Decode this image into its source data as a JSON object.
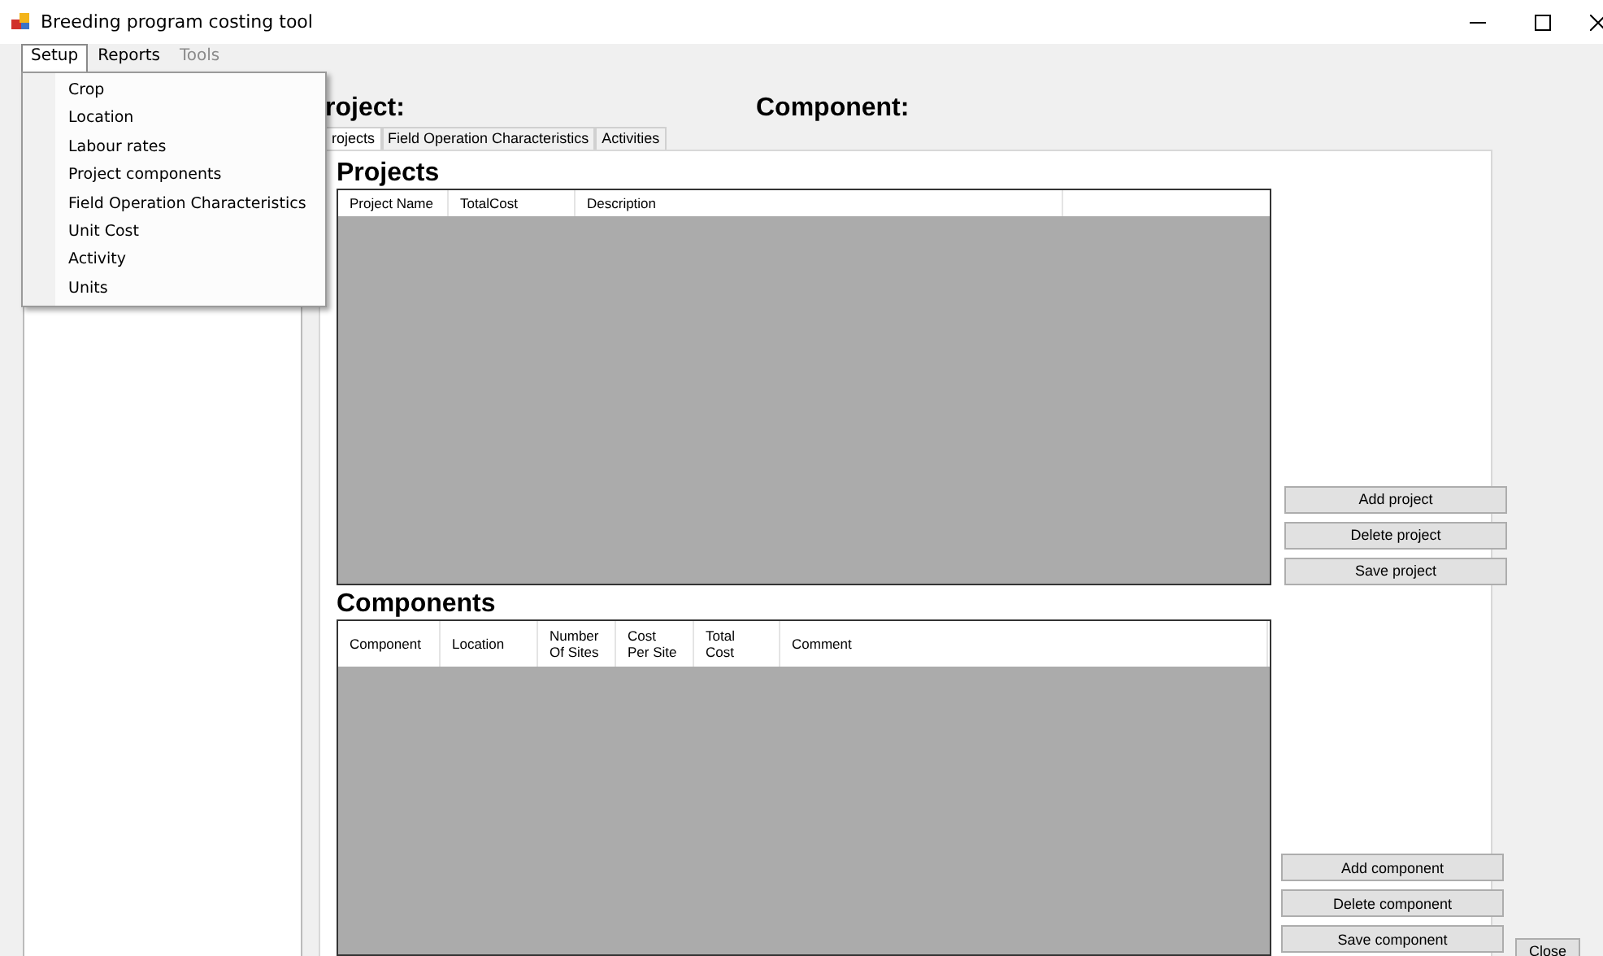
{
  "window": {
    "title": "Breeding program costing tool"
  },
  "menu_bar": [
    {
      "label": "Setup",
      "selected": true,
      "disabled": false
    },
    {
      "label": "Reports",
      "selected": false,
      "disabled": false
    },
    {
      "label": "Tools",
      "selected": false,
      "disabled": true
    }
  ],
  "setup_menu": [
    "Crop",
    "Location",
    "Labour rates",
    "Project components",
    "Field Operation Characteristics",
    "Unit Cost",
    "Activity",
    "Units"
  ],
  "header": {
    "project_label": "roject:",
    "component_label": "Component:"
  },
  "tabs": [
    {
      "label": "rojects",
      "selected": true
    },
    {
      "label": "Field Operation Characteristics",
      "selected": false
    },
    {
      "label": "Activities",
      "selected": false
    }
  ],
  "projects": {
    "title": "Projects",
    "columns": [
      "Project Name",
      "TotalCost",
      "Description"
    ],
    "buttons": [
      "Add project",
      "Delete project",
      "Save project"
    ]
  },
  "components": {
    "title": "Components",
    "columns": [
      "Component",
      "Location",
      "Number\nOf Sites",
      "Cost\nPer Site",
      "Total\nCost",
      "Comment"
    ],
    "buttons": [
      "Add component",
      "Delete component",
      "Save component"
    ]
  },
  "close_button": "Close"
}
